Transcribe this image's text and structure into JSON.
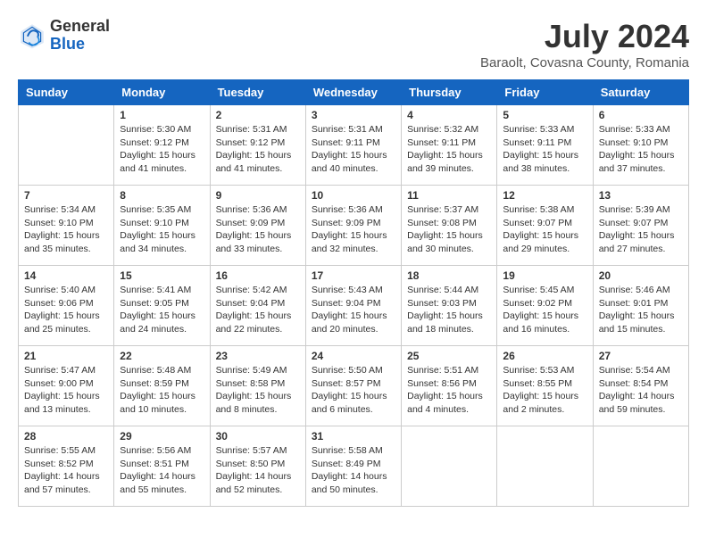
{
  "header": {
    "logo_general": "General",
    "logo_blue": "Blue",
    "month_title": "July 2024",
    "location": "Baraolt, Covasna County, Romania"
  },
  "weekdays": [
    "Sunday",
    "Monday",
    "Tuesday",
    "Wednesday",
    "Thursday",
    "Friday",
    "Saturday"
  ],
  "weeks": [
    [
      {
        "day": "",
        "info": ""
      },
      {
        "day": "1",
        "info": "Sunrise: 5:30 AM\nSunset: 9:12 PM\nDaylight: 15 hours\nand 41 minutes."
      },
      {
        "day": "2",
        "info": "Sunrise: 5:31 AM\nSunset: 9:12 PM\nDaylight: 15 hours\nand 41 minutes."
      },
      {
        "day": "3",
        "info": "Sunrise: 5:31 AM\nSunset: 9:11 PM\nDaylight: 15 hours\nand 40 minutes."
      },
      {
        "day": "4",
        "info": "Sunrise: 5:32 AM\nSunset: 9:11 PM\nDaylight: 15 hours\nand 39 minutes."
      },
      {
        "day": "5",
        "info": "Sunrise: 5:33 AM\nSunset: 9:11 PM\nDaylight: 15 hours\nand 38 minutes."
      },
      {
        "day": "6",
        "info": "Sunrise: 5:33 AM\nSunset: 9:10 PM\nDaylight: 15 hours\nand 37 minutes."
      }
    ],
    [
      {
        "day": "7",
        "info": "Sunrise: 5:34 AM\nSunset: 9:10 PM\nDaylight: 15 hours\nand 35 minutes."
      },
      {
        "day": "8",
        "info": "Sunrise: 5:35 AM\nSunset: 9:10 PM\nDaylight: 15 hours\nand 34 minutes."
      },
      {
        "day": "9",
        "info": "Sunrise: 5:36 AM\nSunset: 9:09 PM\nDaylight: 15 hours\nand 33 minutes."
      },
      {
        "day": "10",
        "info": "Sunrise: 5:36 AM\nSunset: 9:09 PM\nDaylight: 15 hours\nand 32 minutes."
      },
      {
        "day": "11",
        "info": "Sunrise: 5:37 AM\nSunset: 9:08 PM\nDaylight: 15 hours\nand 30 minutes."
      },
      {
        "day": "12",
        "info": "Sunrise: 5:38 AM\nSunset: 9:07 PM\nDaylight: 15 hours\nand 29 minutes."
      },
      {
        "day": "13",
        "info": "Sunrise: 5:39 AM\nSunset: 9:07 PM\nDaylight: 15 hours\nand 27 minutes."
      }
    ],
    [
      {
        "day": "14",
        "info": "Sunrise: 5:40 AM\nSunset: 9:06 PM\nDaylight: 15 hours\nand 25 minutes."
      },
      {
        "day": "15",
        "info": "Sunrise: 5:41 AM\nSunset: 9:05 PM\nDaylight: 15 hours\nand 24 minutes."
      },
      {
        "day": "16",
        "info": "Sunrise: 5:42 AM\nSunset: 9:04 PM\nDaylight: 15 hours\nand 22 minutes."
      },
      {
        "day": "17",
        "info": "Sunrise: 5:43 AM\nSunset: 9:04 PM\nDaylight: 15 hours\nand 20 minutes."
      },
      {
        "day": "18",
        "info": "Sunrise: 5:44 AM\nSunset: 9:03 PM\nDaylight: 15 hours\nand 18 minutes."
      },
      {
        "day": "19",
        "info": "Sunrise: 5:45 AM\nSunset: 9:02 PM\nDaylight: 15 hours\nand 16 minutes."
      },
      {
        "day": "20",
        "info": "Sunrise: 5:46 AM\nSunset: 9:01 PM\nDaylight: 15 hours\nand 15 minutes."
      }
    ],
    [
      {
        "day": "21",
        "info": "Sunrise: 5:47 AM\nSunset: 9:00 PM\nDaylight: 15 hours\nand 13 minutes."
      },
      {
        "day": "22",
        "info": "Sunrise: 5:48 AM\nSunset: 8:59 PM\nDaylight: 15 hours\nand 10 minutes."
      },
      {
        "day": "23",
        "info": "Sunrise: 5:49 AM\nSunset: 8:58 PM\nDaylight: 15 hours\nand 8 minutes."
      },
      {
        "day": "24",
        "info": "Sunrise: 5:50 AM\nSunset: 8:57 PM\nDaylight: 15 hours\nand 6 minutes."
      },
      {
        "day": "25",
        "info": "Sunrise: 5:51 AM\nSunset: 8:56 PM\nDaylight: 15 hours\nand 4 minutes."
      },
      {
        "day": "26",
        "info": "Sunrise: 5:53 AM\nSunset: 8:55 PM\nDaylight: 15 hours\nand 2 minutes."
      },
      {
        "day": "27",
        "info": "Sunrise: 5:54 AM\nSunset: 8:54 PM\nDaylight: 14 hours\nand 59 minutes."
      }
    ],
    [
      {
        "day": "28",
        "info": "Sunrise: 5:55 AM\nSunset: 8:52 PM\nDaylight: 14 hours\nand 57 minutes."
      },
      {
        "day": "29",
        "info": "Sunrise: 5:56 AM\nSunset: 8:51 PM\nDaylight: 14 hours\nand 55 minutes."
      },
      {
        "day": "30",
        "info": "Sunrise: 5:57 AM\nSunset: 8:50 PM\nDaylight: 14 hours\nand 52 minutes."
      },
      {
        "day": "31",
        "info": "Sunrise: 5:58 AM\nSunset: 8:49 PM\nDaylight: 14 hours\nand 50 minutes."
      },
      {
        "day": "",
        "info": ""
      },
      {
        "day": "",
        "info": ""
      },
      {
        "day": "",
        "info": ""
      }
    ]
  ]
}
